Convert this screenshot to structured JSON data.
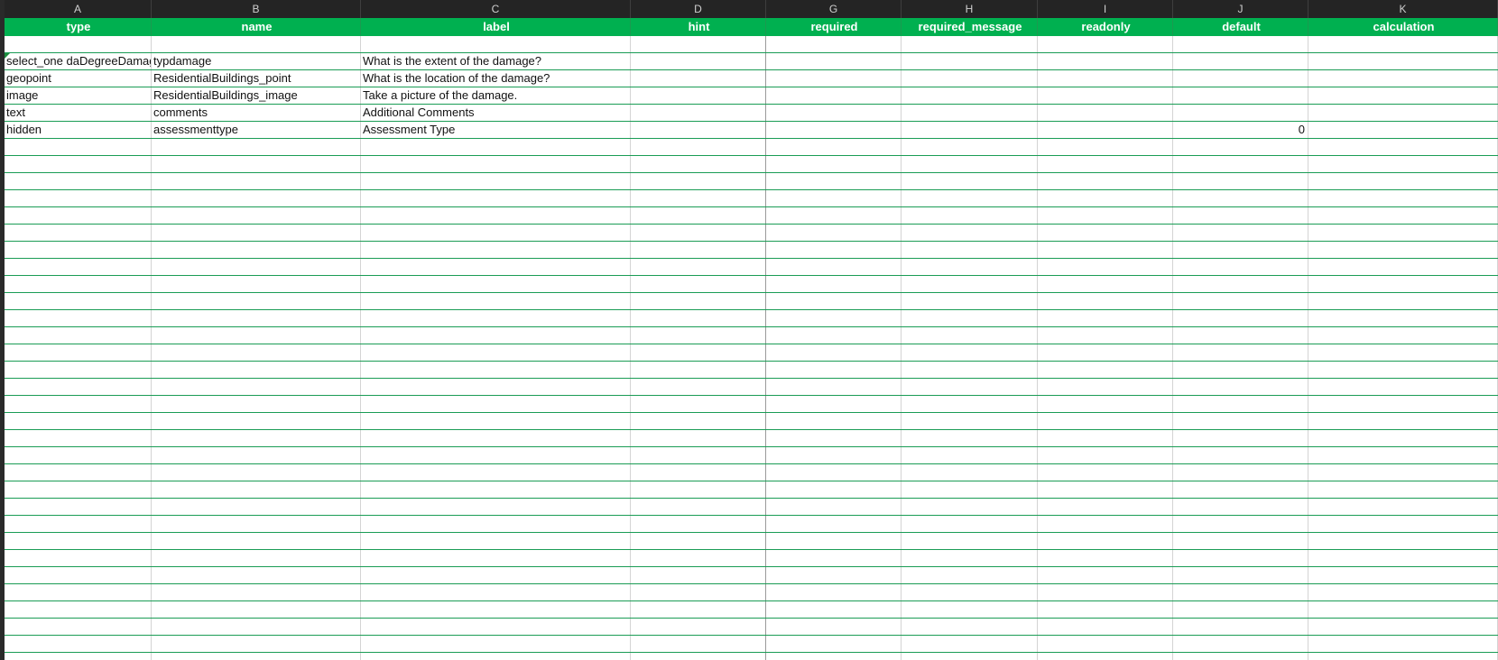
{
  "columns": [
    "A",
    "B",
    "C",
    "D",
    "G",
    "H",
    "I",
    "J",
    "K"
  ],
  "headers": [
    "type",
    "name",
    "label",
    "hint",
    "required",
    "required_message",
    "readonly",
    "default",
    "calculation"
  ],
  "rows": [
    [
      "select_one daDegreeDamage",
      "typdamage",
      "What is the extent of the damage?",
      "",
      "",
      "",
      "",
      "",
      ""
    ],
    [
      "geopoint",
      "ResidentialBuildings_point",
      "What is the location of the damage?",
      "",
      "",
      "",
      "",
      "",
      ""
    ],
    [
      "image",
      "ResidentialBuildings_image",
      "Take a picture of the damage.",
      "",
      "",
      "",
      "",
      "",
      ""
    ],
    [
      "text",
      "comments",
      "Additional Comments",
      "",
      "",
      "",
      "",
      "",
      ""
    ],
    [
      "hidden",
      "assessmenttype",
      "Assessment Type",
      "",
      "",
      "",
      "",
      "0",
      ""
    ]
  ],
  "colors": {
    "header_green": "#00b050",
    "grid_green": "#1a9c55",
    "topbar": "#242424"
  }
}
